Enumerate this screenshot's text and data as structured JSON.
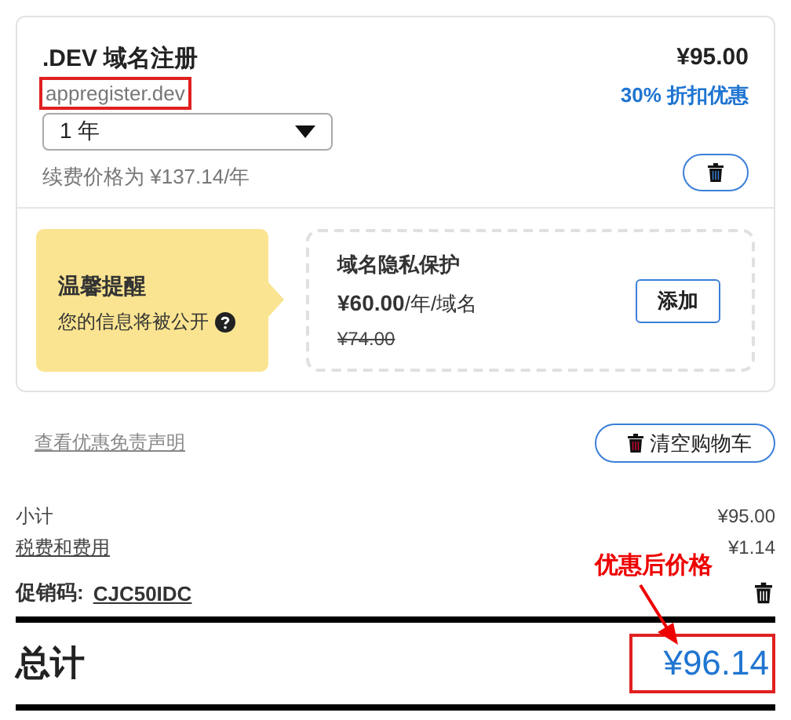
{
  "cart_item": {
    "title": ".DEV 域名注册",
    "domain": "appregister.dev",
    "domain_highlighted": true,
    "term": "1 年",
    "renewal": "续费价格为 ¥137.14/年",
    "price": "¥95.00",
    "discount": "30% 折扣优惠"
  },
  "upsell": {
    "notice_title": "温馨提醒",
    "notice_text": "您的信息将被公开",
    "title": "域名隐私保护",
    "price": "¥60.00",
    "unit": "/年/域名",
    "old_price": "¥74.00",
    "button": "添加"
  },
  "disclaimer_link": "查看优惠免责声明",
  "clear_button": "清空购物车",
  "summary": {
    "rows": [
      {
        "label": "小计",
        "value": "¥95.00",
        "underlined": false
      },
      {
        "label": "税费和费用",
        "value": "¥1.14",
        "underlined": true
      }
    ],
    "promo_label": "促销码:",
    "promo_code": "CJC50IDC",
    "total_label": "总计",
    "total": "¥96.14",
    "total_highlighted": true
  },
  "annotation": {
    "text": "优惠后价格"
  }
}
